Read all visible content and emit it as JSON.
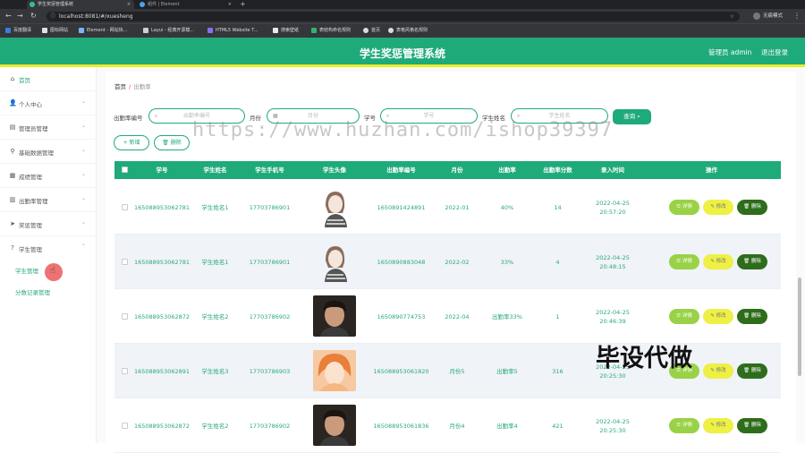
{
  "browser": {
    "tabs": [
      {
        "title": "学生奖惩管理系统",
        "active": true
      },
      {
        "title": "组件 | Element",
        "active": false
      }
    ],
    "url": "localhost:8081/#/xuesheng",
    "profile_label": "无痕模式",
    "bookmarks": [
      "百度翻译",
      "图标网站",
      "Element - 网站快...",
      "Layui - 经典开源模...",
      "HTML5 Website T...",
      "搜索壁纸",
      "表结构命名规则",
      "首页",
      "表格风格名规则"
    ]
  },
  "header": {
    "title": "学生奖惩管理系统",
    "user_label": "管理员 admin",
    "logout_label": "退出登录"
  },
  "sidebar": {
    "items": [
      {
        "label": "首页",
        "icon": "home-icon",
        "glyph": "⌂",
        "caret": ""
      },
      {
        "label": "个人中心",
        "icon": "user-icon",
        "glyph": "👤",
        "caret": "⌄"
      },
      {
        "label": "管理员管理",
        "icon": "admin-icon",
        "glyph": "▤",
        "caret": "⌄"
      },
      {
        "label": "基础数据管理",
        "icon": "location-icon",
        "glyph": "⚲",
        "caret": "⌄"
      },
      {
        "label": "成绩管理",
        "icon": "document-icon",
        "glyph": "▦",
        "caret": "⌄"
      },
      {
        "label": "出勤率管理",
        "icon": "chart-icon",
        "glyph": "▥",
        "caret": "⌄"
      },
      {
        "label": "奖惩管理",
        "icon": "send-icon",
        "glyph": "➤",
        "caret": "⌄"
      },
      {
        "label": "学生管理",
        "icon": "help-icon",
        "glyph": "?",
        "caret": "⌃"
      }
    ],
    "sub_items": [
      "学生管理",
      "分数记录管理"
    ]
  },
  "breadcrumb": {
    "home": "首页",
    "separator": "/",
    "current": "出勤率"
  },
  "filters": {
    "labels": [
      "出勤率编号",
      "月份",
      "学号",
      "学生姓名"
    ],
    "placeholders": [
      "出勤率编号",
      "月份",
      "学号",
      "学生姓名"
    ],
    "query_label": "查询",
    "add_label": "+ 新增",
    "delete_label": "删除"
  },
  "table": {
    "columns": [
      "学号",
      "学生姓名",
      "学生手机号",
      "学生头像",
      "出勤率编号",
      "月份",
      "出勤率",
      "出勤率分数",
      "录入时间",
      "操作"
    ],
    "rows": [
      {
        "id": "165088953062781",
        "name": "学生姓名1",
        "phone": "17703786901",
        "code": "1650891424891",
        "month": "2022-01",
        "rate": "40%",
        "score": "14",
        "time": "2022-04-25 20:57:20"
      },
      {
        "id": "165088953062781",
        "name": "学生姓名1",
        "phone": "17703786901",
        "code": "1650890883048",
        "month": "2022-02",
        "rate": "33%",
        "score": "4",
        "time": "2022-04-25 20:48:15"
      },
      {
        "id": "165088953062872",
        "name": "学生姓名2",
        "phone": "17703786902",
        "code": "1650890774753",
        "month": "2022-04",
        "rate": "出勤率33%",
        "score": "1",
        "time": "2022-04-25 20:46:39"
      },
      {
        "id": "165088953062891",
        "name": "学生姓名3",
        "phone": "17703786903",
        "code": "165088953061820",
        "month": "月份5",
        "rate": "出勤率5",
        "score": "316",
        "time": "2022-04-25 20:25:30"
      },
      {
        "id": "165088953062872",
        "name": "学生姓名2",
        "phone": "17703786902",
        "code": "165088953061836",
        "month": "月份4",
        "rate": "出勤率4",
        "score": "421",
        "time": "2022-04-25 20:25:30"
      }
    ],
    "actions": {
      "detail": "详情",
      "edit": "修改",
      "delete": "删除"
    }
  },
  "watermark": {
    "url_text": "https://www.huzhan.com/ishop39397",
    "overlay_text": "毕设代做"
  },
  "colors": {
    "primary": "#1faa7a",
    "accent_yellow": "#ecec2a",
    "btn_detail": "#9ad247",
    "btn_edit": "#eef043",
    "btn_delete": "#2e6d1b"
  }
}
